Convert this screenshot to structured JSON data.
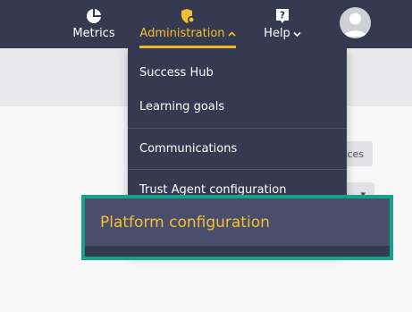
{
  "topbar": {
    "metrics_label": "Metrics",
    "administration_label": "Administration",
    "help_label": "Help"
  },
  "icons": {
    "metrics": "pie-chart-icon",
    "administration": "shield-gear-icon",
    "help": "question-box-icon",
    "avatar": "user-avatar-icon"
  },
  "colors": {
    "nav_bg": "#363a50",
    "accent": "#f2c12e",
    "highlight_border": "#18a28c"
  },
  "menu": {
    "items": [
      {
        "label": "Success Hub"
      },
      {
        "label": "Learning goals"
      },
      {
        "label": "Communications"
      },
      {
        "label": "Trust Agent configuration"
      },
      {
        "label": "Platform configuration"
      }
    ]
  },
  "background": {
    "pill_1_text": "ces",
    "pill_2_text": "▾"
  }
}
